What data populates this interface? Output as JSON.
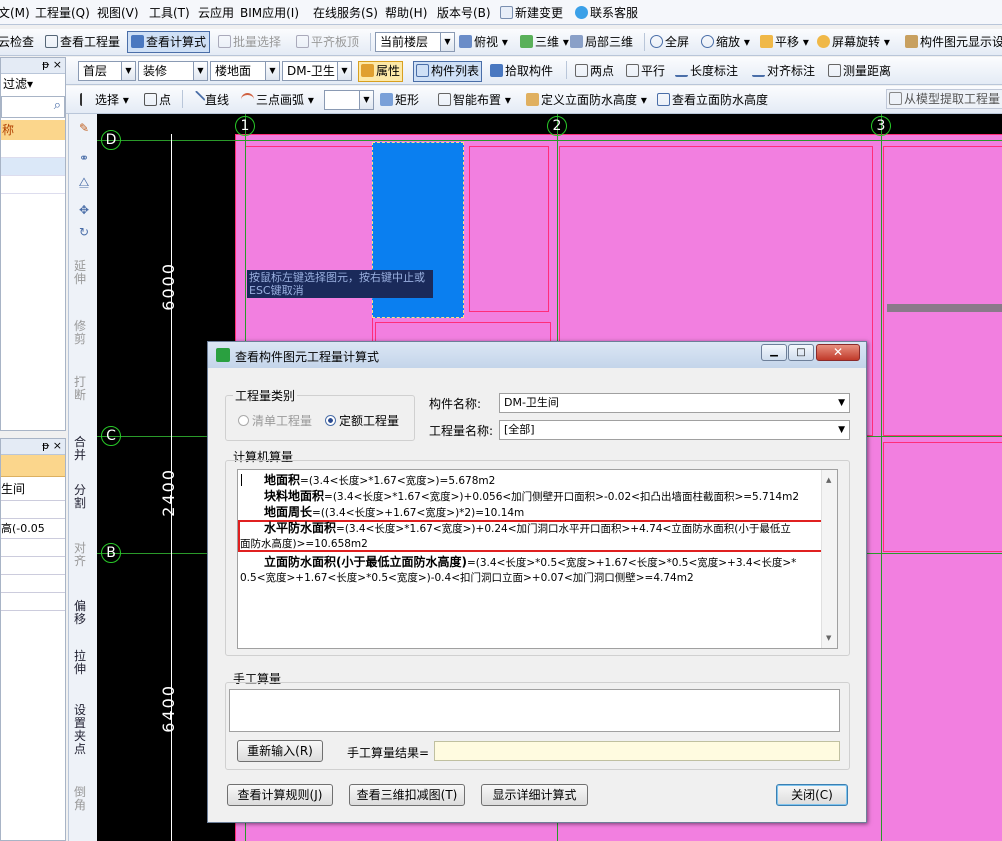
{
  "menu": [
    "文(M)",
    "工程量(Q)",
    "视图(V)",
    "工具(T)",
    "云应用",
    "BIM应用(I)",
    "在线服务(S)",
    "帮助(H)",
    "版本号(B)",
    "新建变更",
    "联系客服"
  ],
  "toolbar1": {
    "items": [
      "云检查",
      "查看工程量",
      "查看计算式",
      "批量选择",
      "平齐板顶"
    ],
    "floor_select": "当前楼层",
    "view_items": [
      "俯视",
      "三维",
      "局部三维",
      "全屏",
      "缩放",
      "平移",
      "屏幕旋转",
      "构件图元显示设"
    ]
  },
  "toolbar2": {
    "floor": "首层",
    "category": "装修",
    "type": "楼地面",
    "component": "DM-卫生",
    "buttons": [
      "属性",
      "构件列表",
      "拾取构件",
      "两点",
      "平行",
      "长度标注",
      "对齐标注",
      "测量距离"
    ]
  },
  "toolbar3": {
    "items": [
      "选择",
      "点",
      "直线",
      "三点画弧",
      "矩形",
      "智能布置",
      "定义立面防水高度",
      "查看立面防水高度",
      "从模型提取工程量"
    ]
  },
  "left_panel": {
    "pin": "ᵽ",
    "close": "×",
    "filter": "过滤",
    "items": [
      "称",
      ""
    ],
    "panel2_items": [
      "生间",
      "高(-0.05"
    ]
  },
  "vertical_tools": [
    "延伸",
    "修剪",
    "打断",
    "合并",
    "分割",
    "对齐",
    "偏移",
    "拉伸",
    "设置夹点",
    "倒角"
  ],
  "canvas": {
    "axes_top": [
      "1",
      "2",
      "3"
    ],
    "axes_left": [
      "D",
      "C",
      "B"
    ],
    "dims": [
      "6000",
      "2400",
      "6400"
    ],
    "tooltip": "按鼠标左键选择图元，按右键中止或ESC键取消",
    "colors": {
      "pink": "#f27fe0",
      "blue": "#0a7ff0",
      "red_line": "#ff2d7a",
      "axis": "#28c828"
    }
  },
  "dialog": {
    "title": "查看构件图元工程量计算式",
    "type_group_label": "工程量类别",
    "radio_list": "清单工程量",
    "radio_quota": "定额工程量",
    "component_name_label": "构件名称:",
    "component_name_value": "DM-卫生间",
    "quantity_name_label": "工程量名称:",
    "quantity_name_value": "[全部]",
    "computer_label": "计算机算量",
    "lines": [
      {
        "name": "地面积",
        "formula": "=(3.4<长度>*1.67<宽度>)=5.678m2"
      },
      {
        "name": "块料地面积",
        "formula": "=(3.4<长度>*1.67<宽度>)+0.056<加门侧壁开口面积>-0.02<扣凸出墙面柱截面积>=5.714m2"
      },
      {
        "name": "地面周长",
        "formula": "=((3.4<长度>+1.67<宽度>)*2)=10.14m"
      },
      {
        "name": "水平防水面积",
        "formula": "=(3.4<长度>*1.67<宽度>)+0.24<加门洞口水平开口面积>+4.74<立面防水面积(小于最低立",
        "formula2": "面防水高度)>=10.658m2"
      },
      {
        "name": "立面防水面积(小于最低立面防水高度)",
        "formula": "=(3.4<长度>*0.5<宽度>+1.67<长度>*0.5<宽度>+3.4<长度>*",
        "formula2": "0.5<宽度>+1.67<长度>*0.5<宽度>)-0.4<扣门洞口立面>+0.07<加门洞口侧壁>=4.74m2"
      }
    ],
    "manual_label": "手工算量",
    "reinput_button": "重新输入(R)",
    "manual_result_label": "手工算量结果=",
    "btn_rules": "查看计算规则(J)",
    "btn_3d": "查看三维扣减图(T)",
    "btn_detail": "显示详细计算式",
    "btn_close": "关闭(C)"
  }
}
